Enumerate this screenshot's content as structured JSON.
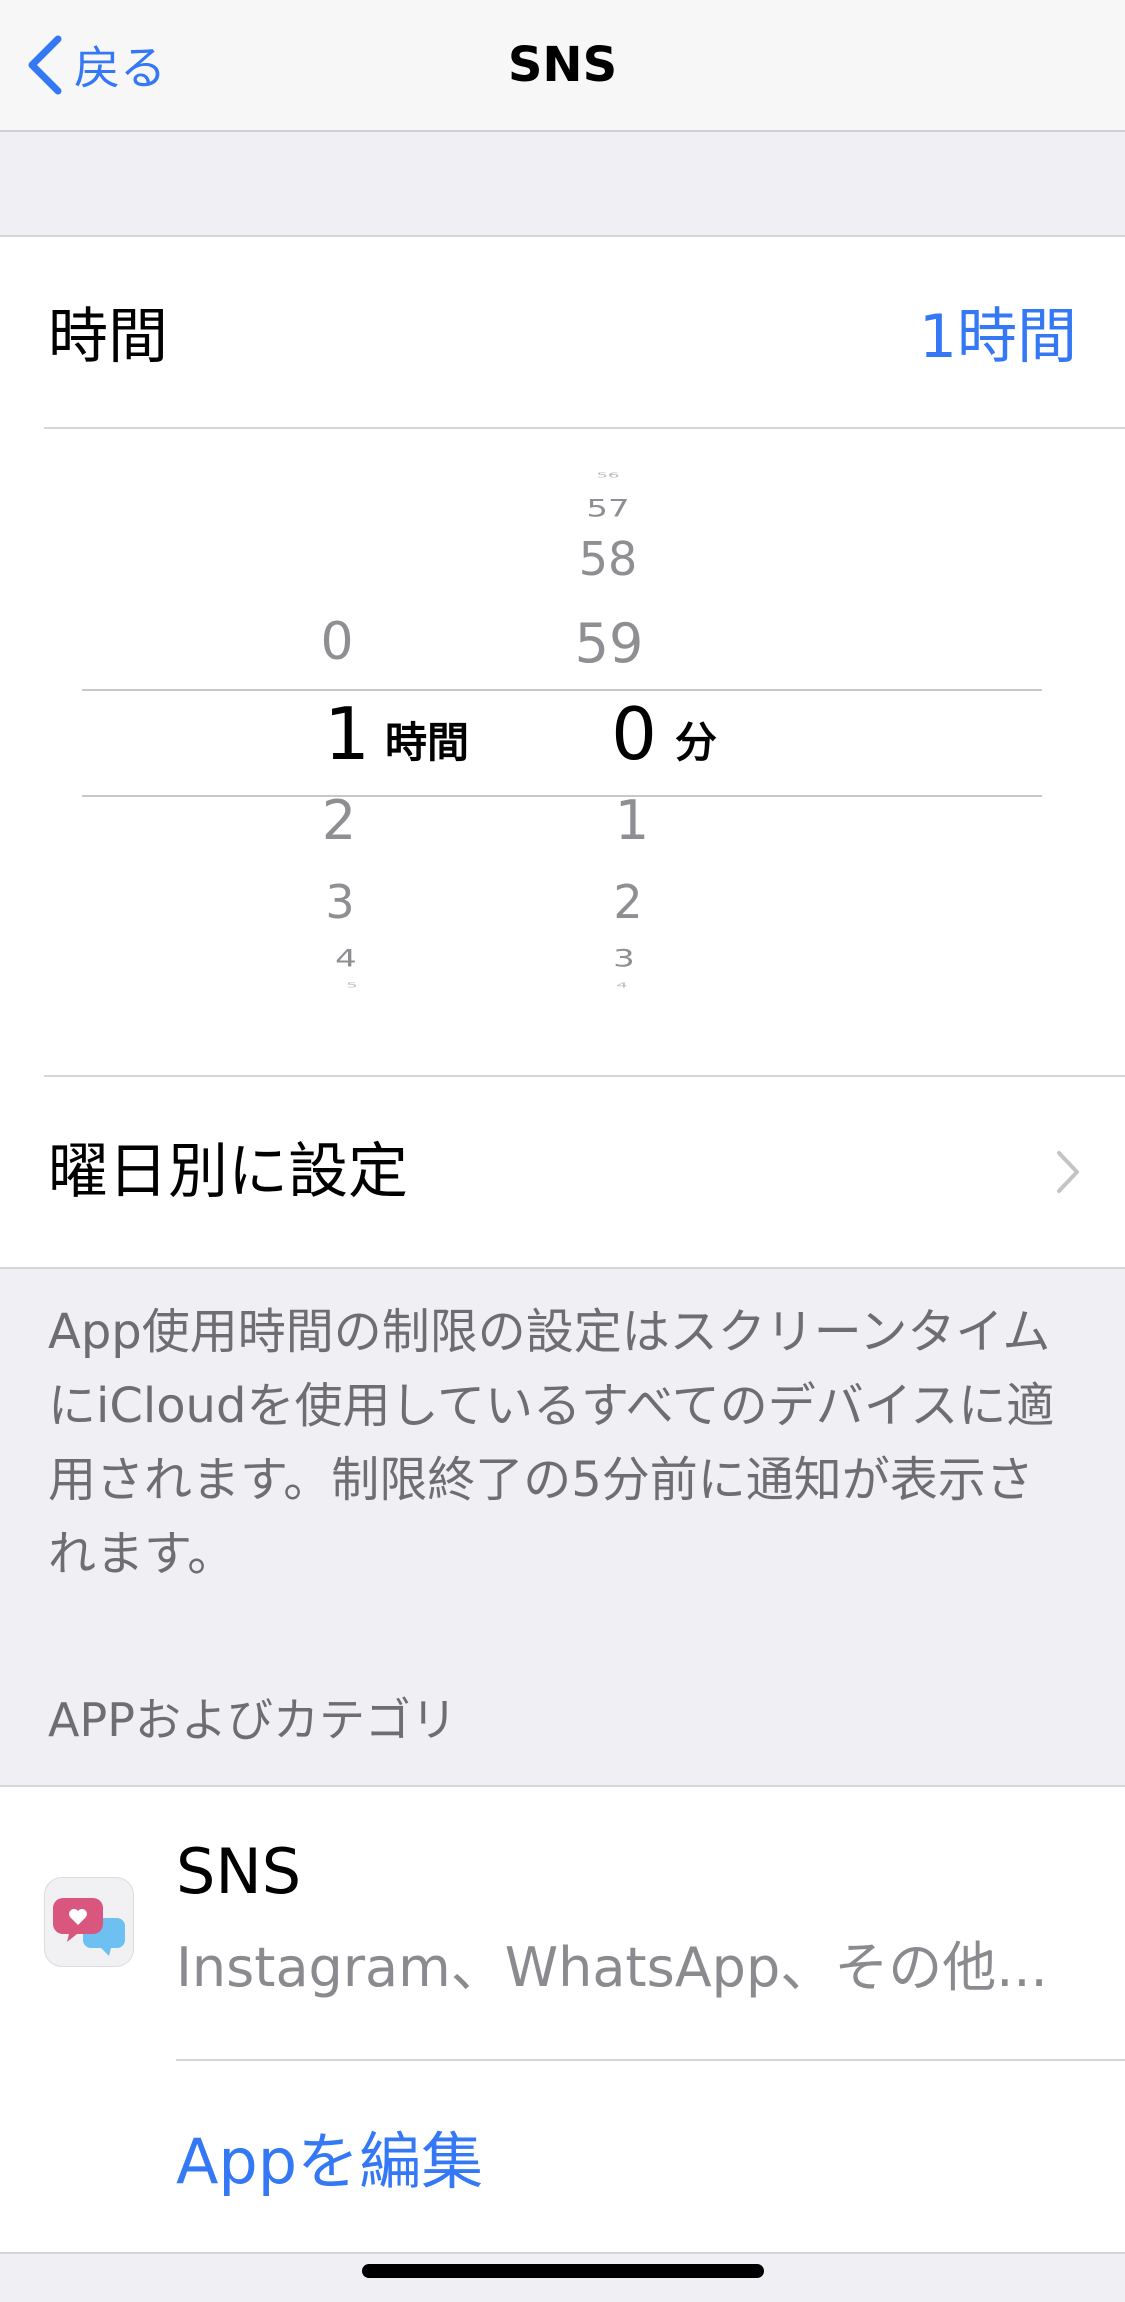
{
  "nav": {
    "back_label": "戻る",
    "title": "SNS"
  },
  "limit": {
    "time_label": "時間",
    "time_value": "1時間",
    "picker": {
      "hours": {
        "selected": "1",
        "above": [
          "0"
        ],
        "below": [
          "2",
          "3",
          "4",
          "5"
        ],
        "unit": "時間"
      },
      "minutes": {
        "selected": "0",
        "above": [
          "56",
          "57",
          "58",
          "59"
        ],
        "below": [
          "1",
          "2",
          "3",
          "4"
        ],
        "unit": "分"
      }
    },
    "weekday_label": "曜日別に設定"
  },
  "footnote": "App使用時間の制限の設定はスクリーンタイムにiCloudを使用しているすべてのデバイスに適用されます。制限終了の5分前に通知が表示されます。",
  "apps_section": {
    "header": "APPおよびカテゴリ",
    "item": {
      "icon": "social-chat-heart-icon",
      "title": "SNS",
      "subtitle": "Instagram、WhatsApp、その他..."
    },
    "edit_label": "Appを編集"
  },
  "colors": {
    "accent": "#3478f6",
    "background": "#efeff4"
  }
}
